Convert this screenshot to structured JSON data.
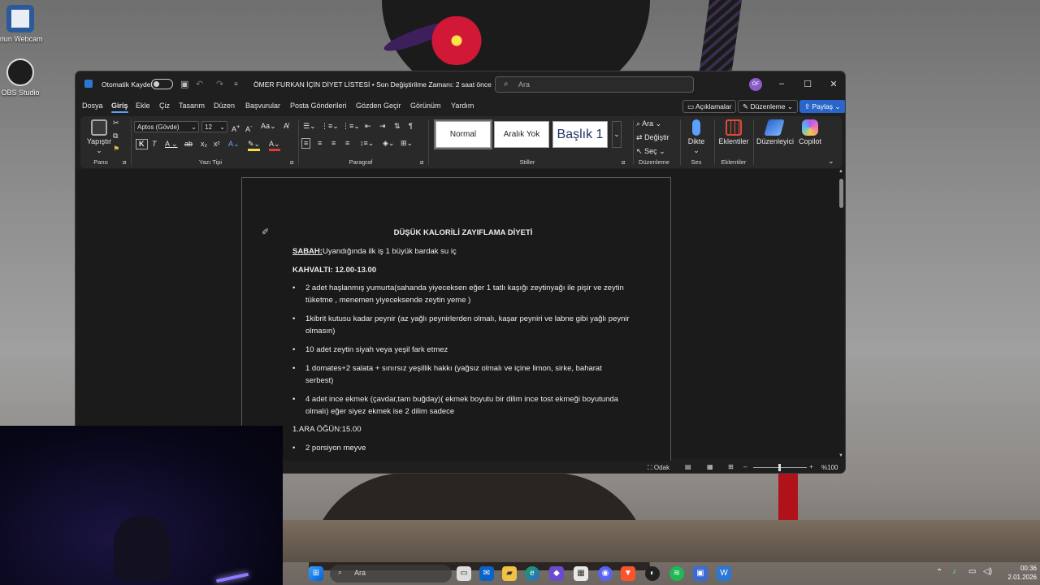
{
  "desktop": {
    "icons": [
      {
        "label": "Iriun Webcam",
        "icon": "webcam-icon"
      },
      {
        "label": "OBS Studio",
        "icon": "obs-icon"
      }
    ]
  },
  "window": {
    "titlebar": {
      "autosave_label": "Otomatik Kaydet",
      "title": "ÖMER FURKAN İÇİN DİYET LİSTESİ • Son Değiştirilme Zamanı: 2 saat önce",
      "search_placeholder": "Ara",
      "avatar_initials": "ÖF"
    },
    "menu": {
      "tabs": [
        "Dosya",
        "Giriş",
        "Ekle",
        "Çiz",
        "Tasarım",
        "Düzen",
        "Başvurular",
        "Posta Gönderileri",
        "Gözden Geçir",
        "Görünüm",
        "Yardım"
      ],
      "active_tab": "Giriş",
      "comments_label": "Açıklamalar",
      "editing_label": "Düzenleme",
      "share_label": "Paylaş"
    },
    "ribbon": {
      "paste_label": "Yapıştır",
      "font_name": "Aptos (Gövde)",
      "font_size": "12",
      "styles": [
        "Normal",
        "Aralık Yok",
        "Başlık 1"
      ],
      "find_label": "Ara",
      "replace_label": "Değiştir",
      "select_label": "Seç",
      "dictate_label": "Dikte",
      "addins_label": "Eklentiler",
      "editor_label": "Düzenleyici",
      "copilot_label": "Copilot",
      "groups": {
        "clipboard": "Pano",
        "font": "Yazı Tipi",
        "paragraph": "Paragraf",
        "styles": "Stiller",
        "editing": "Düzenleme",
        "voice": "Ses",
        "addins": "Eklentiler"
      }
    },
    "document": {
      "title": "DÜŞÜK KALORİLİ ZAYIFLAMA DİYETİ",
      "morning_label": "SABAH:",
      "morning_text": "Uyandığında ilk iş 1 büyük bardak su iç",
      "breakfast_heading": "KAHVALTI: 12.00-13.00",
      "breakfast_items": [
        "2 adet haşlanmış yumurta(sahanda yiyeceksen eğer 1 tatlı kaşığı zeytinyağı ile pişir ve zeytin tüketme , menemen yiyeceksende zeytin yeme )",
        "1kibrit kutusu kadar peynir (az yağlı peynirlerden olmalı, kaşar peyniri ve labne gibi yağlı peynir olmasın)",
        "10 adet zeytin siyah veya yeşil fark etmez",
        "1 domates+2 salata + sınırsız yeşillik hakkı (yağsız olmalı ve içine limon, sirke, baharat serbest)",
        "4 adet ince  ekmek (çavdar,tam buğday)( ekmek boyutu bir dilim ince tost ekmeği boyutunda olmalı) eğer siyez ekmek ise 2 dilim sadece"
      ],
      "snack_heading": "1.ARA ÖĞÜN:15.00",
      "snack_items": [
        "2 porsiyon meyve"
      ]
    },
    "statusbar": {
      "focus_label": "Odak",
      "zoom": "%100"
    }
  },
  "taskbar": {
    "search_placeholder": "Ara",
    "time": "00:36",
    "date": "2.01.2026"
  },
  "colors": {
    "accent": "#2a66c9",
    "word_blue": "#2b78d4",
    "copilot": "#b05cf0"
  }
}
